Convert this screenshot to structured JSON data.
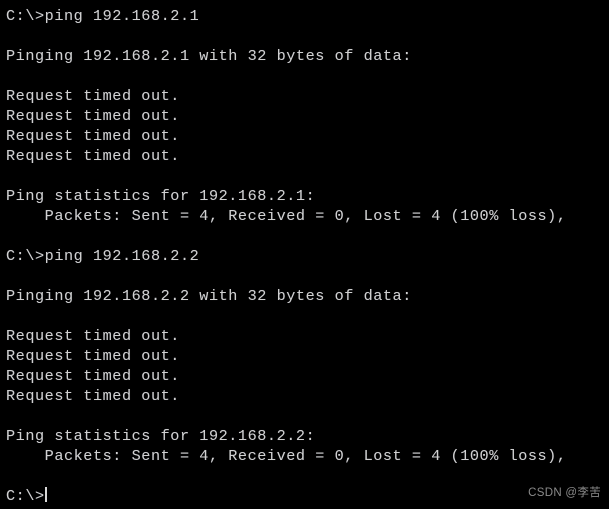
{
  "terminal": {
    "background_color": "#000000",
    "text_color": "#d0d0d0",
    "lines": [
      {
        "id": "prompt-1",
        "text": "C:\\>ping 192.168.2.1"
      },
      {
        "id": "blank-1",
        "text": ""
      },
      {
        "id": "pinging-1",
        "text": "Pinging 192.168.2.1 with 32 bytes of data:"
      },
      {
        "id": "blank-2",
        "text": ""
      },
      {
        "id": "timeout-1-1",
        "text": "Request timed out."
      },
      {
        "id": "timeout-1-2",
        "text": "Request timed out."
      },
      {
        "id": "timeout-1-3",
        "text": "Request timed out."
      },
      {
        "id": "timeout-1-4",
        "text": "Request timed out."
      },
      {
        "id": "blank-3",
        "text": ""
      },
      {
        "id": "stats-header-1",
        "text": "Ping statistics for 192.168.2.1:"
      },
      {
        "id": "stats-packets-1",
        "text": "    Packets: Sent = 4, Received = 0, Lost = 4 (100% loss),"
      },
      {
        "id": "blank-4",
        "text": ""
      },
      {
        "id": "prompt-2",
        "text": "C:\\>ping 192.168.2.2"
      },
      {
        "id": "blank-5",
        "text": ""
      },
      {
        "id": "pinging-2",
        "text": "Pinging 192.168.2.2 with 32 bytes of data:"
      },
      {
        "id": "blank-6",
        "text": ""
      },
      {
        "id": "timeout-2-1",
        "text": "Request timed out."
      },
      {
        "id": "timeout-2-2",
        "text": "Request timed out."
      },
      {
        "id": "timeout-2-3",
        "text": "Request timed out."
      },
      {
        "id": "timeout-2-4",
        "text": "Request timed out."
      },
      {
        "id": "blank-7",
        "text": ""
      },
      {
        "id": "stats-header-2",
        "text": "Ping statistics for 192.168.2.2:"
      },
      {
        "id": "stats-packets-2",
        "text": "    Packets: Sent = 4, Received = 0, Lost = 4 (100% loss),"
      },
      {
        "id": "blank-8",
        "text": ""
      }
    ],
    "final_prompt": "C:\\>"
  },
  "watermark": {
    "text": "CSDN @李苦",
    "color": "#8a8a8a"
  }
}
